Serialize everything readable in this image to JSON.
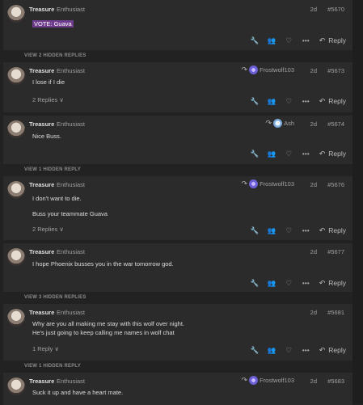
{
  "posts": [
    {
      "user": "Treasure",
      "title": "Enthusiast",
      "age": "2d",
      "num": "#5670",
      "body": [
        "VOTE: Guava"
      ],
      "vote": true
    },
    {
      "user": "Treasure",
      "title": "Enthusiast",
      "age": "2d",
      "num": "#5673",
      "reply_to": "Frostwolf103",
      "body": [
        "I lose if I die"
      ],
      "replies": "2 Replies"
    },
    {
      "user": "Treasure",
      "title": "Enthusiast",
      "age": "2d",
      "num": "#5674",
      "reply_to": "Ash",
      "body": [
        "Nice Buss."
      ]
    },
    {
      "user": "Treasure",
      "title": "Enthusiast",
      "age": "2d",
      "num": "#5676",
      "reply_to": "Frostwolf103",
      "body": [
        "I don't want to die.",
        "Buss your teammate Guava"
      ],
      "replies": "2 Replies"
    },
    {
      "user": "Treasure",
      "title": "Enthusiast",
      "age": "2d",
      "num": "#5677",
      "body": [
        "I hope Phoenix busses you in the war tomorrow god."
      ]
    },
    {
      "user": "Treasure",
      "title": "Enthusiast",
      "age": "2d",
      "num": "#5681",
      "body": [
        "Why are you all making me stay with this wolf over night.",
        "He's just going to keep calling me names in wolf chat"
      ],
      "replies": "1 Reply"
    },
    {
      "user": "Treasure",
      "title": "Enthusiast",
      "age": "2d",
      "num": "#5683",
      "reply_to": "Frostwolf103",
      "body": [
        "Suck it up and have a heart mate."
      ]
    }
  ],
  "gaps": [
    "VIEW 2 HIDDEN REPLIES",
    "VIEW 1 HIDDEN REPLY",
    "VIEW 3 HIDDEN REPLIES",
    "VIEW 1 HIDDEN REPLY"
  ],
  "actions": {
    "reply_label": "Reply"
  },
  "icons": {
    "wrench": "wrench-icon",
    "people": "people-icon",
    "heart": "heart-icon",
    "more": "more-icon",
    "reply": "reply-icon"
  }
}
